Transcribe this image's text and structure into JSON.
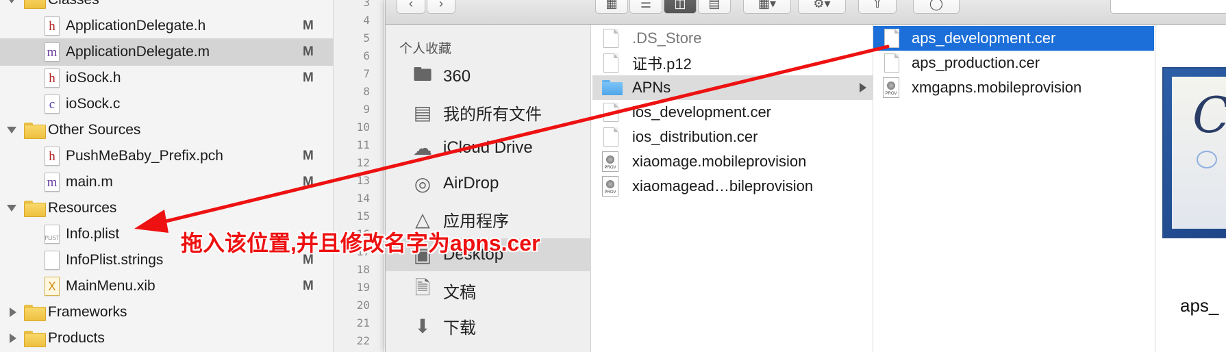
{
  "navigator": {
    "rows": [
      {
        "label": "Classes",
        "badge": ""
      },
      {
        "label": "ApplicationDelegate.h",
        "badge": "M",
        "icon_letter": "h"
      },
      {
        "label": "ApplicationDelegate.m",
        "badge": "M",
        "icon_letter": "m"
      },
      {
        "label": "ioSock.h",
        "badge": "M",
        "icon_letter": "h"
      },
      {
        "label": "ioSock.c",
        "badge": "",
        "icon_letter": "c"
      },
      {
        "label": "Other Sources",
        "badge": ""
      },
      {
        "label": "PushMeBaby_Prefix.pch",
        "badge": "M",
        "icon_letter": "h"
      },
      {
        "label": "main.m",
        "badge": "M",
        "icon_letter": "m"
      },
      {
        "label": "Resources",
        "badge": ""
      },
      {
        "label": "Info.plist",
        "badge": "",
        "icon_letter": "PLIST"
      },
      {
        "label": "InfoPlist.strings",
        "badge": "M"
      },
      {
        "label": "MainMenu.xib",
        "badge": "M",
        "icon_letter": "X"
      },
      {
        "label": "Frameworks",
        "badge": ""
      },
      {
        "label": "Products",
        "badge": ""
      }
    ]
  },
  "gutter": {
    "line_numbers": [
      "3",
      "4",
      "5",
      "6",
      "7",
      "8",
      "9",
      "10",
      "11",
      "12",
      "13",
      "14",
      "15",
      "16",
      "17",
      "18",
      "19",
      "20",
      "21",
      "22"
    ]
  },
  "finder": {
    "sidebar": {
      "header": "个人收藏",
      "items": [
        {
          "label": "360",
          "icon": "folder-icon"
        },
        {
          "label": "我的所有文件",
          "icon": "all-files-icon"
        },
        {
          "label": "iCloud Drive",
          "icon": "cloud-icon"
        },
        {
          "label": "AirDrop",
          "icon": "airdrop-icon"
        },
        {
          "label": "应用程序",
          "icon": "applications-icon"
        },
        {
          "label": "Desktop",
          "icon": "desktop-icon"
        },
        {
          "label": "文稿",
          "icon": "documents-icon"
        },
        {
          "label": "下载",
          "icon": "downloads-icon"
        }
      ]
    },
    "column1": {
      "items": [
        {
          "label": ".DS_Store",
          "kind": "doc"
        },
        {
          "label": "证书.p12",
          "kind": "doc"
        },
        {
          "label": "APNs",
          "kind": "folder"
        },
        {
          "label": "ios_development.cer",
          "kind": "doc"
        },
        {
          "label": "ios_distribution.cer",
          "kind": "doc"
        },
        {
          "label": "xiaomage.mobileprovision",
          "kind": "prov"
        },
        {
          "label": "xiaomagead…bileprovision",
          "kind": "prov"
        }
      ],
      "prov_icon_text": "PROV"
    },
    "column2": {
      "items": [
        {
          "label": "aps_development.cer",
          "kind": "doc"
        },
        {
          "label": "aps_production.cer",
          "kind": "doc"
        },
        {
          "label": "xmgapns.mobileprovision",
          "kind": "prov"
        }
      ]
    },
    "preview": {
      "name": "aps_",
      "glyph": "C"
    }
  },
  "annotation": {
    "text": "拖入该位置,并且修改名字为apns.cer",
    "color": "#ee1111"
  },
  "colors": {
    "selection_blue": "#1c6fd8",
    "selection_gray": "#d4d4d4",
    "folder_yellow": "#f9d86a",
    "folder_blue": "#4fa6e8"
  }
}
